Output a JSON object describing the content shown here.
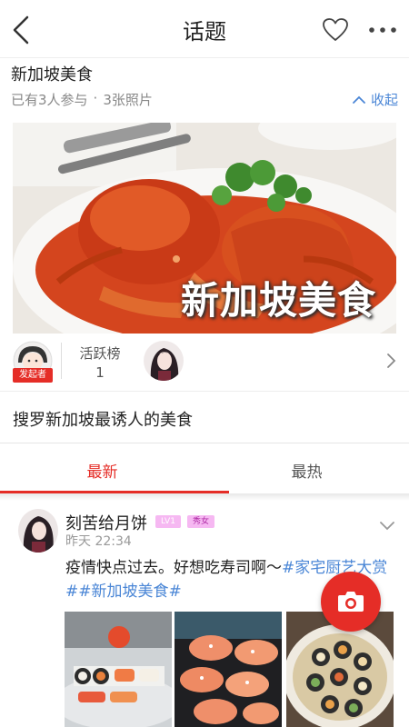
{
  "nav": {
    "title": "话题",
    "back_icon": "chevron-left-icon",
    "fav_icon": "heart-icon",
    "more_icon": "more-dots-icon"
  },
  "topic": {
    "name": "新加坡美食",
    "participants": "已有3人参与",
    "separator": "·",
    "photos": "3张照片",
    "collapse_label": "收起",
    "banner_text": "新加坡美食",
    "initiator_badge": "发起者",
    "active_rank_label": "活跃榜",
    "active_rank_value": "1",
    "description": "搜罗新加坡最诱人的美食"
  },
  "tabs": [
    {
      "label": "最新",
      "active": true
    },
    {
      "label": "最热",
      "active": false
    }
  ],
  "post": {
    "username": "刻苦给月饼",
    "level_badge": "LV1",
    "role_badge": "秀女",
    "time": "昨天 22:34",
    "text": "疫情快点过去。好想吃寿司啊～",
    "tags": "#家宅厨艺大赏##新加坡美食#",
    "images": [
      "sushi-platter",
      "salmon-rolls",
      "maki-plate"
    ]
  },
  "colors": {
    "accent": "#e52d27",
    "link": "#4a86d6",
    "badge": "#f6b8f2"
  }
}
